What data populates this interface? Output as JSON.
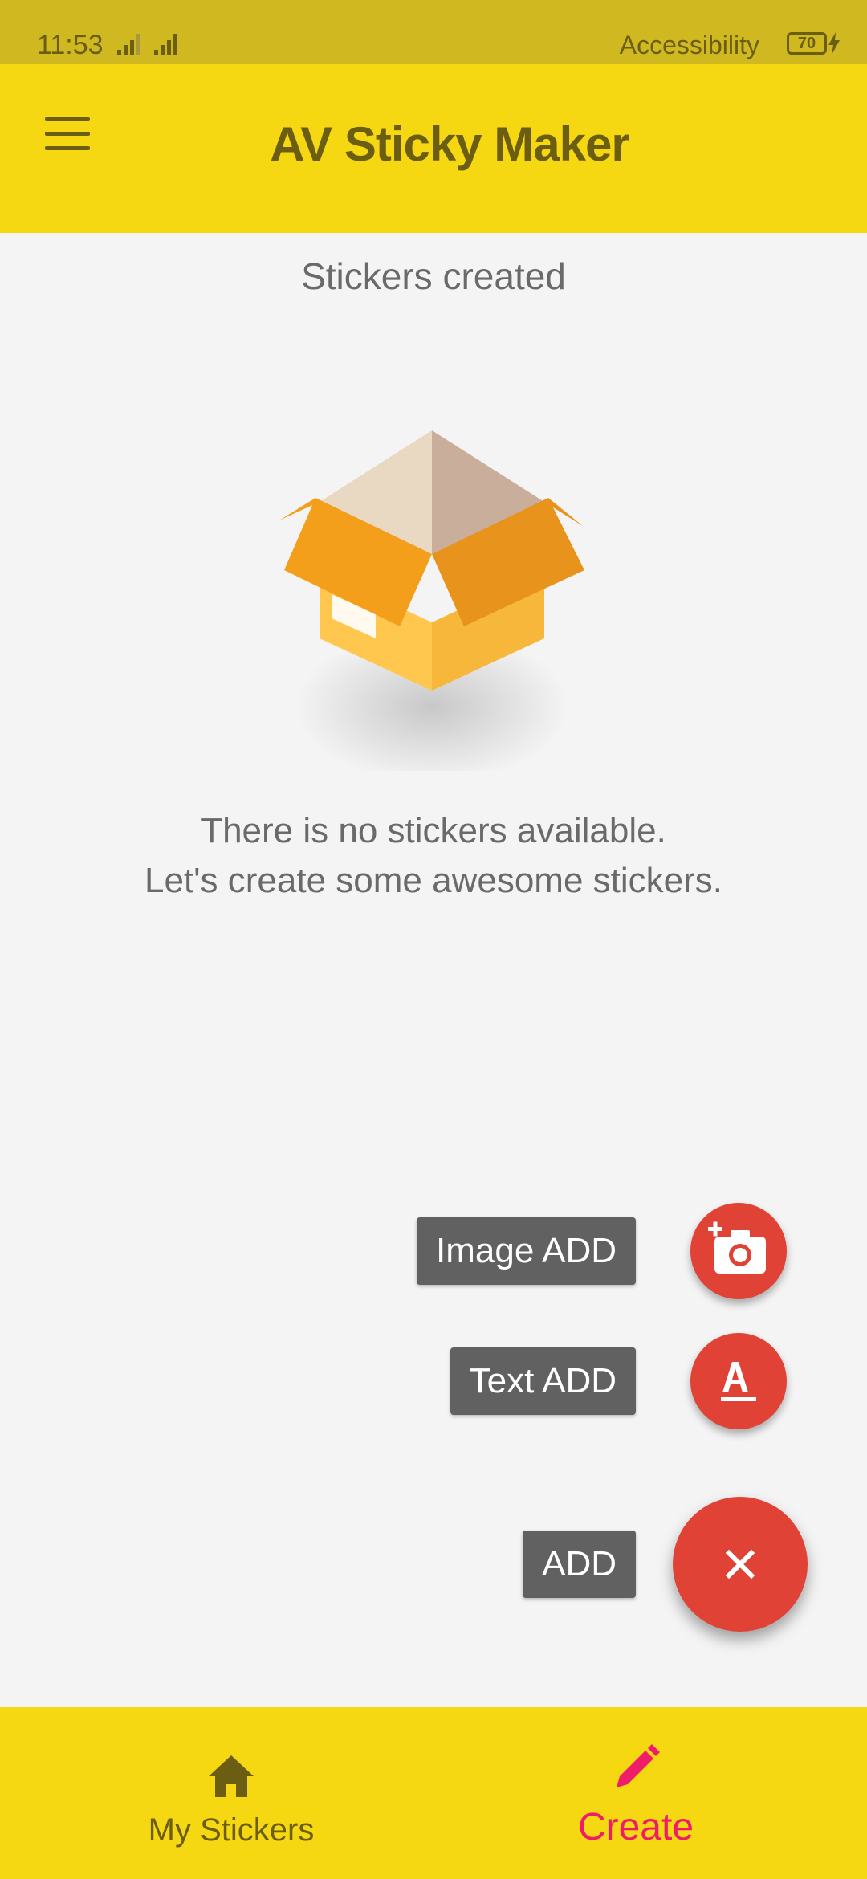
{
  "status_bar": {
    "time": "11:53",
    "accessibility_label": "Accessibility",
    "battery_level": "70"
  },
  "app_bar": {
    "title": "AV Sticky Maker",
    "menu_icon": "hamburger-menu-icon"
  },
  "main": {
    "section_title": "Stickers created",
    "empty_line_1": "There is no stickers available.",
    "empty_line_2": "Let's create some awesome stickers.",
    "illustration": "open-box-icon"
  },
  "fab_menu": {
    "image_add_label": "Image ADD",
    "image_add_icon": "add-photo-icon",
    "text_add_label": "Text ADD",
    "text_add_icon": "text-format-icon",
    "main_label": "ADD",
    "main_icon": "close-icon",
    "fab_color": "#e04236",
    "label_color": "#616161"
  },
  "bottom_nav": {
    "items": [
      {
        "label": "My Stickers",
        "icon": "home-icon",
        "selected": false,
        "color": "#6b5e12"
      },
      {
        "label": "Create",
        "icon": "pencil-icon",
        "selected": true,
        "color": "#ef1c6c"
      }
    ],
    "background": "#f5d712"
  },
  "colors": {
    "app_bar": "#f5d712",
    "status_bar": "#cfb820",
    "accent": "#e04236",
    "background": "#f4f4f4"
  }
}
